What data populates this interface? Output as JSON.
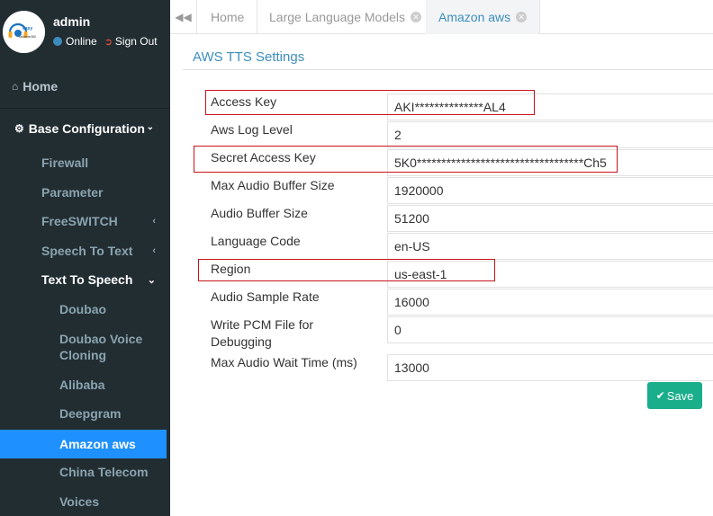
{
  "user": {
    "name": "admin",
    "status": "Online",
    "signout": "Sign Out",
    "logo_text": "easy callcenter365",
    "status_color": "#3c8dbc"
  },
  "sidebar": {
    "home": "Home",
    "base_config": "Base Configuration",
    "items": [
      {
        "label": "Firewall"
      },
      {
        "label": "Parameter"
      },
      {
        "label": "FreeSWITCH"
      },
      {
        "label": "Speech To Text"
      },
      {
        "label": "Text To Speech"
      },
      {
        "label": "Doubao"
      },
      {
        "label": "Doubao Voice Cloning"
      },
      {
        "label": "Alibaba"
      },
      {
        "label": "Deepgram"
      },
      {
        "label": "Amazon aws"
      },
      {
        "label": "China Telecom"
      },
      {
        "label": "Voices"
      }
    ],
    "active_color": "#1e90ff"
  },
  "tabs": [
    {
      "label": "Home"
    },
    {
      "label": "Large Language Models"
    },
    {
      "label": "Amazon aws"
    }
  ],
  "page": {
    "title": "AWS TTS Settings",
    "save_label": "Save",
    "save_color": "#1aae8a"
  },
  "settings": [
    {
      "label": "Access Key",
      "value": "AKI**************AL4"
    },
    {
      "label": "Aws Log Level",
      "value": "2"
    },
    {
      "label": "Secret Access Key",
      "value": "5K0**********************************Ch5"
    },
    {
      "label": "Max Audio Buffer Size",
      "value": "1920000"
    },
    {
      "label": "Audio Buffer Size",
      "value": "51200"
    },
    {
      "label": "Language Code",
      "value": "en-US"
    },
    {
      "label": "Region",
      "value": "us-east-1"
    },
    {
      "label": "Audio Sample Rate",
      "value": "16000"
    },
    {
      "label": "Write PCM File for Debugging",
      "value": "0"
    },
    {
      "label": "Max Audio Wait Time (ms)",
      "value": "13000"
    }
  ],
  "highlight_color": "#c9131b"
}
